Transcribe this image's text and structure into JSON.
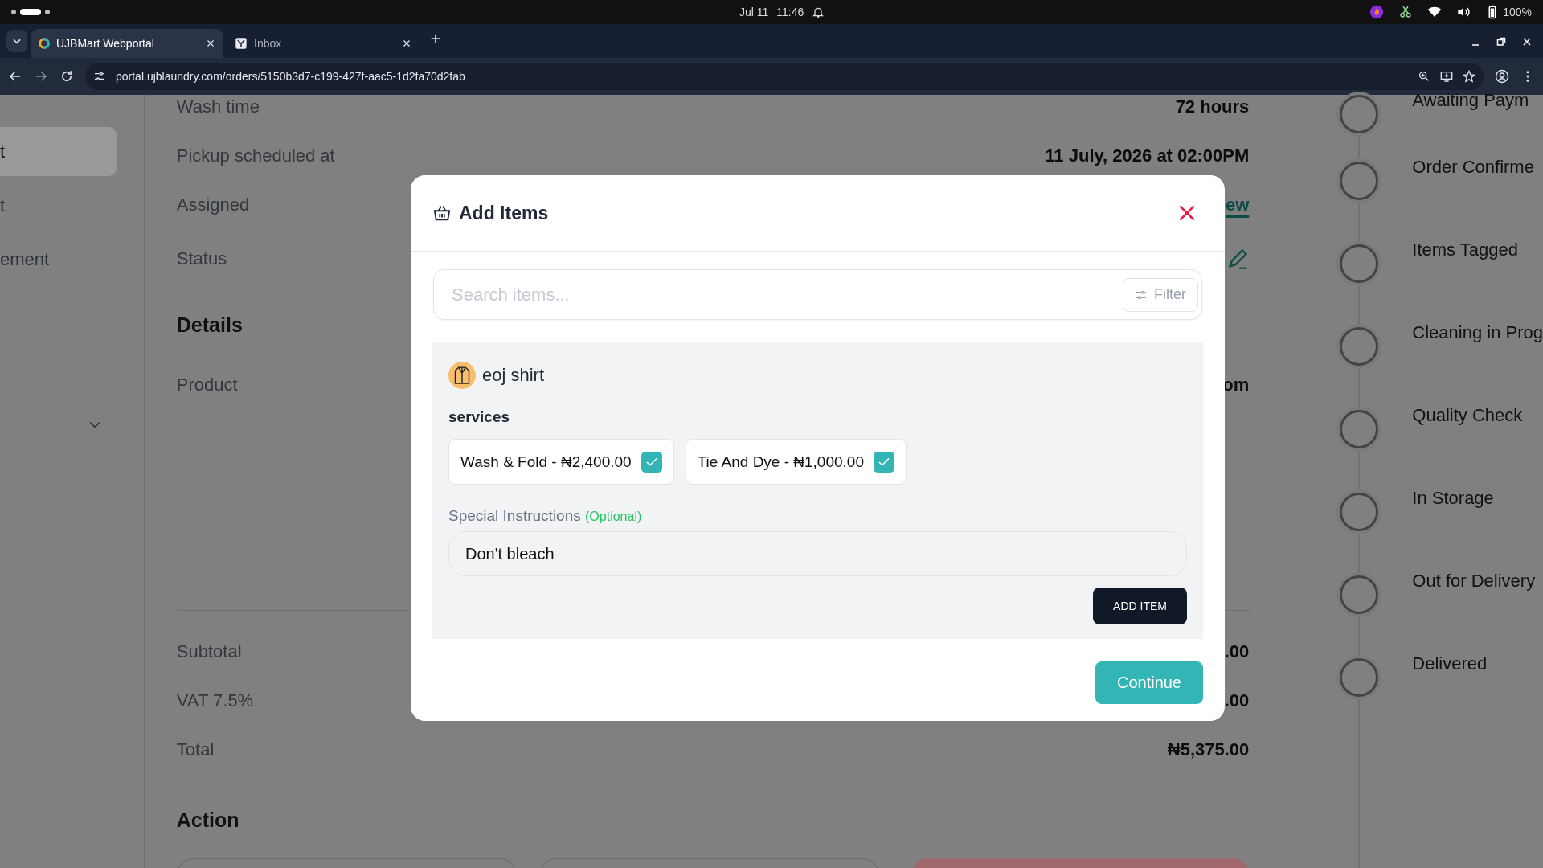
{
  "system_bar": {
    "date": "Jul 11",
    "time": "11:46",
    "battery": "100%"
  },
  "browser": {
    "tabs": [
      {
        "title": "UJBMart Webportal",
        "selected": true
      },
      {
        "title": "Inbox",
        "selected": false
      }
    ],
    "url": "portal.ujblaundry.com/orders/5150b3d7-c199-427f-aac5-1d2fa70d2fab"
  },
  "sidebar": {
    "items": [
      {
        "label": "t",
        "selected": true
      },
      {
        "label": "t",
        "selected": false
      },
      {
        "label": "ement",
        "selected": false
      }
    ]
  },
  "order": {
    "rows": [
      {
        "kind": "text",
        "label": "Wash time",
        "value": "72 hours"
      },
      {
        "kind": "text",
        "label": "Pickup scheduled at",
        "value": "11 July, 2026 at 02:00PM"
      },
      {
        "kind": "link",
        "label": "Assigned",
        "value": "ew"
      },
      {
        "kind": "edit",
        "label": "Status"
      }
    ],
    "details_title": "Details",
    "product": {
      "label": "Product",
      "value": "om"
    },
    "totals": [
      {
        "label": "Subtotal",
        "value": ".00"
      },
      {
        "label": "VAT 7.5%",
        "value": ".00"
      },
      {
        "label": "Total",
        "value": "₦5,375.00"
      }
    ],
    "action_title": "Action",
    "actions": [
      {
        "kind": "outline"
      },
      {
        "kind": "outline"
      },
      {
        "kind": "danger"
      }
    ]
  },
  "timeline": [
    {
      "label": "Awaiting Paym"
    },
    {
      "label": "Order Confirme"
    },
    {
      "label": "Items Tagged"
    },
    {
      "label": "Cleaning in Prog"
    },
    {
      "label": "Quality Check"
    },
    {
      "label": "In Storage"
    },
    {
      "label": "Out for Delivery"
    },
    {
      "label": "Delivered"
    }
  ],
  "modal": {
    "title": "Add Items",
    "search": {
      "placeholder": "Search items..."
    },
    "filter": "Filter",
    "item": {
      "name": "eoj shirt",
      "services_label": "services",
      "services": [
        {
          "label": "Wash & Fold - ₦2,400.00",
          "checked": true
        },
        {
          "label": "Tie And Dye - ₦1,000.00",
          "checked": true
        }
      ],
      "instructions_label": "Special Instructions",
      "optional": "(Optional)",
      "instructions": "Don't bleach",
      "add_button": "ADD ITEM"
    },
    "continue": "Continue"
  }
}
